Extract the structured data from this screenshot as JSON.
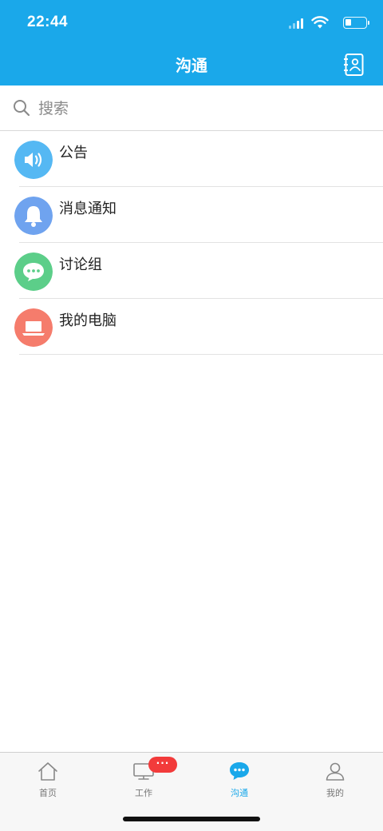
{
  "status_bar": {
    "time": "22:44"
  },
  "header": {
    "title": "沟通",
    "contacts_icon": "contacts-book-icon"
  },
  "search": {
    "placeholder": "搜索",
    "value": ""
  },
  "list": [
    {
      "label": "公告",
      "icon": "speaker-icon",
      "color": "#55b8f3"
    },
    {
      "label": "消息通知",
      "icon": "bell-icon",
      "color": "#6fa3ef"
    },
    {
      "label": "讨论组",
      "icon": "chat-icon",
      "color": "#5cce89"
    },
    {
      "label": "我的电脑",
      "icon": "laptop-icon",
      "color": "#f57c6c"
    }
  ],
  "tabbar": {
    "tabs": [
      {
        "label": "首页",
        "icon": "home-icon",
        "active": false
      },
      {
        "label": "工作",
        "icon": "monitor-icon",
        "active": false,
        "badge": "···"
      },
      {
        "label": "沟通",
        "icon": "chat-bubble-icon",
        "active": true
      },
      {
        "label": "我的",
        "icon": "user-icon",
        "active": false
      }
    ]
  },
  "colors": {
    "primary": "#1aa8ea",
    "badge": "#f23b3b"
  }
}
